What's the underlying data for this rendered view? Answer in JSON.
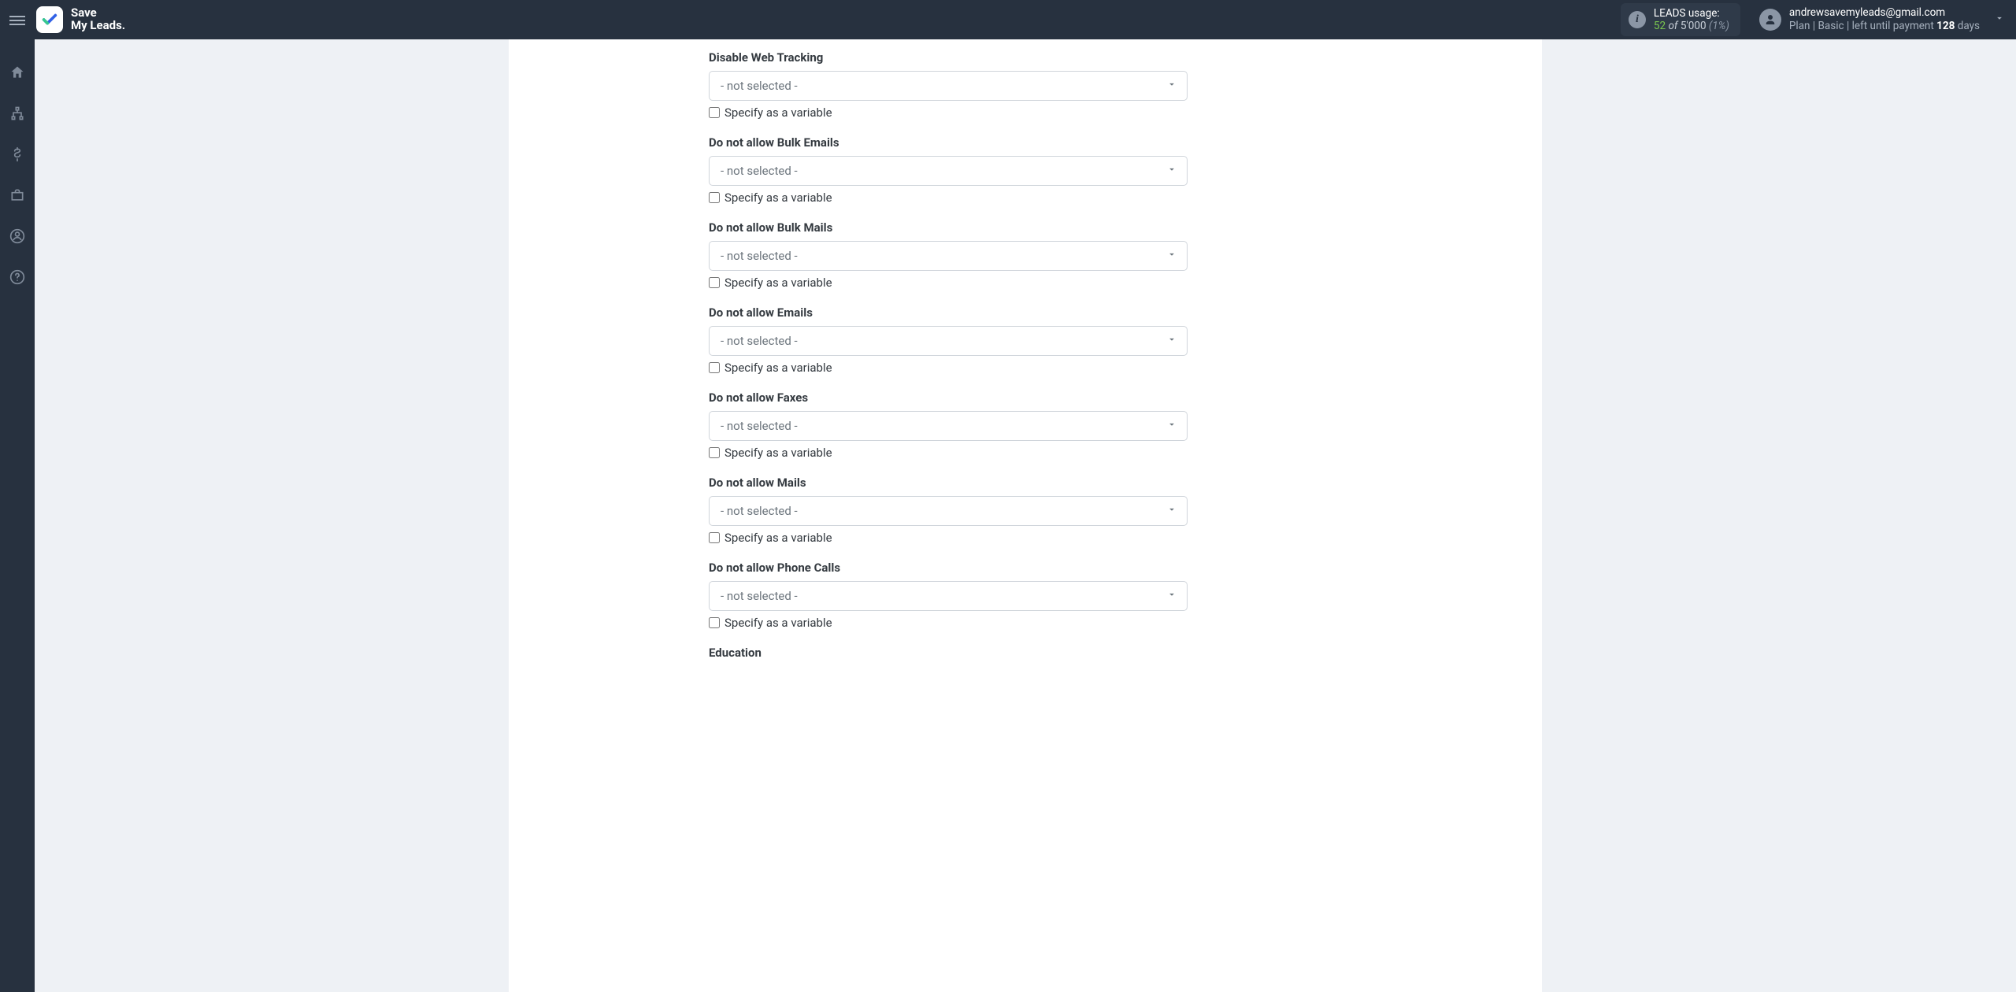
{
  "header": {
    "logo_line1": "Save",
    "logo_line2": "My Leads.",
    "usage": {
      "label": "LEADS usage:",
      "used": "52",
      "of": "of",
      "limit": "5'000",
      "pct": "(1%)"
    },
    "account": {
      "email": "andrewsavemyleads@gmail.com",
      "plan_prefix": "Plan |",
      "plan_name": "Basic",
      "plan_mid": "| left until payment",
      "days_num": "128",
      "days_word": "days"
    }
  },
  "sidebar": {
    "items": [
      {
        "icon": "home"
      },
      {
        "icon": "sitemap"
      },
      {
        "icon": "dollar"
      },
      {
        "icon": "briefcase"
      },
      {
        "icon": "user"
      },
      {
        "icon": "question"
      }
    ]
  },
  "form": {
    "not_selected": "- not selected -",
    "specify_variable": "Specify as a variable",
    "fields": [
      {
        "label": "Disable Web Tracking"
      },
      {
        "label": "Do not allow Bulk Emails"
      },
      {
        "label": "Do not allow Bulk Mails"
      },
      {
        "label": "Do not allow Emails"
      },
      {
        "label": "Do not allow Faxes"
      },
      {
        "label": "Do not allow Mails"
      },
      {
        "label": "Do not allow Phone Calls"
      }
    ],
    "trailing_label": "Education"
  }
}
